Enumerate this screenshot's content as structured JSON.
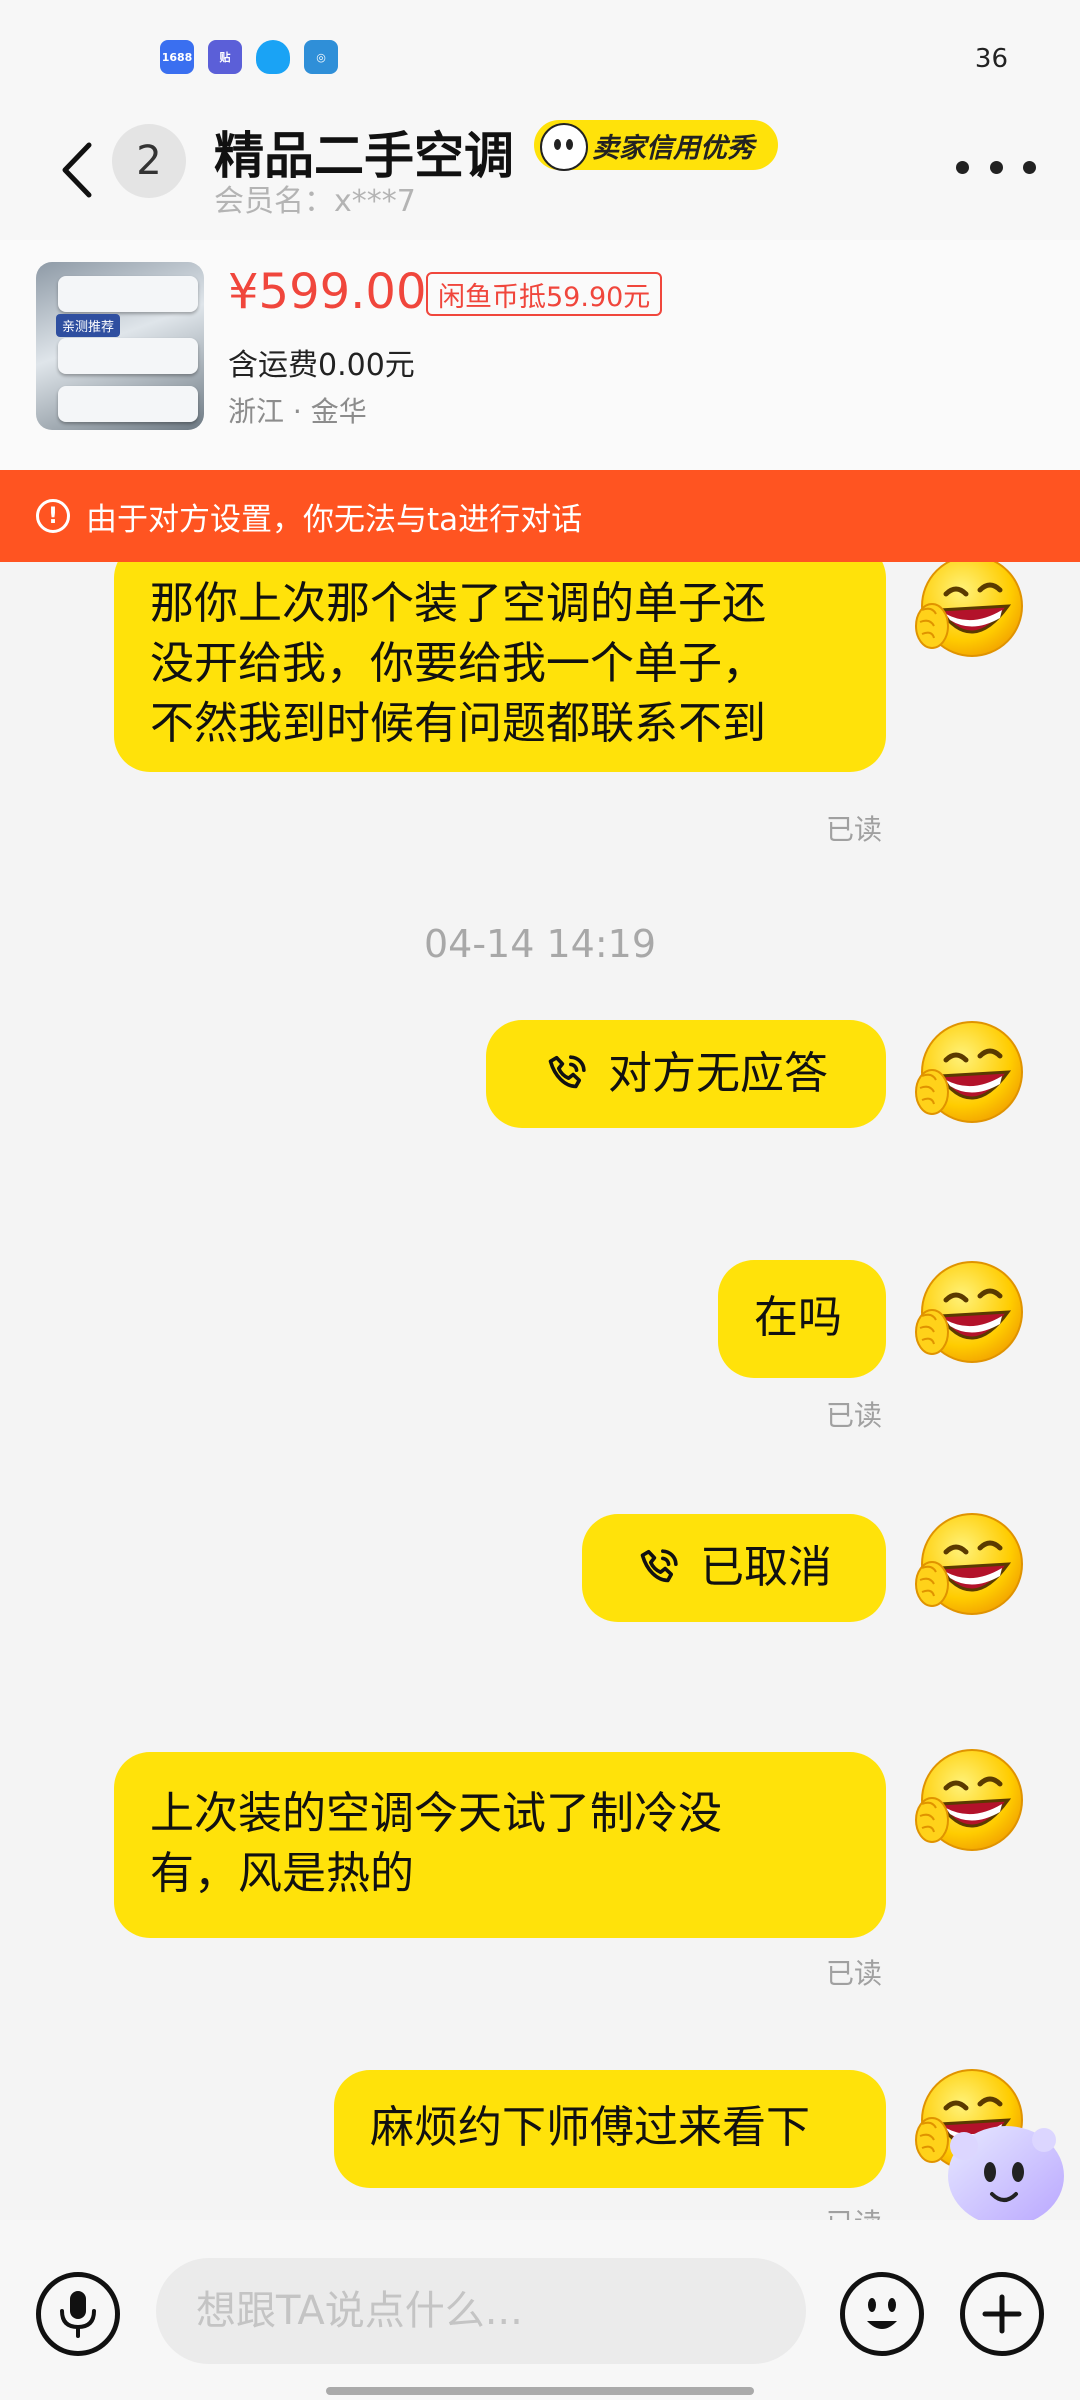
{
  "status_bar": {
    "apps": [
      {
        "label": "1688",
        "icon": "app-1688-icon",
        "color": "#3a6ff0"
      },
      {
        "label": "贴",
        "icon": "app-tie-icon",
        "color": "#5b5fd8"
      },
      {
        "label": "",
        "icon": "qq-icon",
        "color": "#1aa3f5"
      },
      {
        "label": "",
        "icon": "app-camera-icon",
        "color": "#2f8fd8"
      }
    ],
    "time": "36"
  },
  "header": {
    "unread_count": "2",
    "title": "精品二手空调",
    "credit_badge": "卖家信用优秀",
    "member": "会员名：x***7"
  },
  "product": {
    "image_tag": "亲测推荐",
    "price": "¥599.00",
    "coin_offset": "闲鱼币抵59.90元",
    "shipping": "含运费0.00元",
    "location": "浙江 · 金华"
  },
  "warning": {
    "text": "由于对方设置，你无法与ta进行对话"
  },
  "messages": [
    {
      "type": "text",
      "lines": [
        "那你上次那个装了空调的单子还",
        "没开给我，你要给我一个单子，",
        "不然我到时候有问题都联系不到"
      ],
      "read": "已读"
    },
    {
      "type": "timestamp",
      "text": "04-14 14:19"
    },
    {
      "type": "call",
      "text": "对方无应答"
    },
    {
      "type": "text",
      "lines": [
        "在吗"
      ],
      "read": "已读"
    },
    {
      "type": "call",
      "text": "已取消"
    },
    {
      "type": "text",
      "lines": [
        "上次装的空调今天试了制冷没",
        "有，风是热的"
      ],
      "read": "已读"
    },
    {
      "type": "text",
      "lines": [
        "麻烦约下师傅过来看下"
      ],
      "read": "已读"
    }
  ],
  "input": {
    "placeholder": "想跟TA说点什么..."
  },
  "colors": {
    "bubble": "#ffe20a",
    "warning": "#ff5421",
    "price": "#f0463c"
  }
}
